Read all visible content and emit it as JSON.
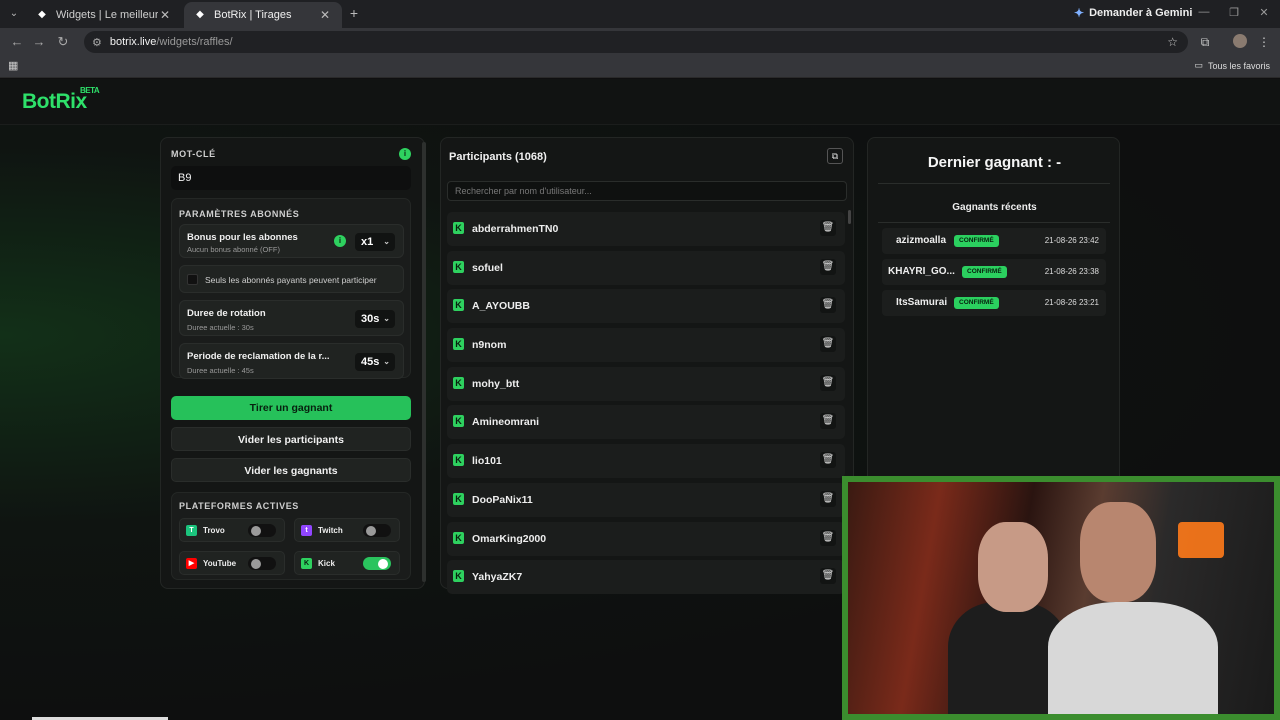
{
  "browser": {
    "tabs": [
      {
        "title": "Widgets | Le meilleur logiciel p",
        "active": false
      },
      {
        "title": "BotRix | Tirages",
        "active": true
      }
    ],
    "gemini_label": "Demander à Gemini",
    "url_host": "botrix.live",
    "url_path": "/widgets/raffles/",
    "bookmarks_label": "Tous les favoris"
  },
  "app": {
    "logo": "BotRix",
    "logo_badge": "BETA"
  },
  "left_panel": {
    "keyword_label": "MOT-CLÉ",
    "keyword_value": "B9",
    "sub_settings_label": "PARAMÈTRES ABONNÉS",
    "bonus_title": "Bonus pour les abonnes",
    "bonus_sub": "Aucun bonus abonné (OFF)",
    "bonus_value": "x1",
    "paid_only_label": "Seuls les abonnés payants peuvent participer",
    "rotation_title": "Duree de rotation",
    "rotation_sub": "Duree actuelle : 30s",
    "rotation_value": "30s",
    "claim_title": "Periode de reclamation de la r...",
    "claim_sub": "Duree actuelle : 45s",
    "claim_value": "45s",
    "draw_button": "Tirer un gagnant",
    "clear_participants_button": "Vider les participants",
    "clear_winners_button": "Vider les gagnants",
    "platforms_label": "PLATEFORMES ACTIVES",
    "platforms": [
      {
        "name": "Trovo",
        "enabled": false,
        "color": "#1bc47d"
      },
      {
        "name": "Twitch",
        "enabled": false,
        "color": "#9146ff"
      },
      {
        "name": "YouTube",
        "enabled": false,
        "color": "#ff0000"
      },
      {
        "name": "Kick",
        "enabled": true,
        "color": "#2ed15f"
      }
    ]
  },
  "participants": {
    "title": "Participants (1068)",
    "search_placeholder": "Rechercher par nom d'utilisateur...",
    "list": [
      "abderrahmenTN0",
      "sofuel",
      "A_AYOUBB",
      "n9nom",
      "mohy_btt",
      "Amineomrani",
      "lio101",
      "DooPaNix11",
      "OmarKing2000",
      "YahyaZK7"
    ]
  },
  "winners": {
    "last_winner": "Dernier gagnant : -",
    "recent_title": "Gagnants récents",
    "recent": [
      {
        "name": "azizmoalla",
        "status": "CONFIRMÉ",
        "date": "21-08-26 23:42"
      },
      {
        "name": "KHAYRI_GO...",
        "status": "CONFIRMÉ",
        "date": "21-08-26 23:38"
      },
      {
        "name": "ItsSamurai",
        "status": "CONFIRMÉ",
        "date": "21-08-26 23:21"
      }
    ]
  },
  "colors": {
    "accent": "#26c15a",
    "background": "#0f0f10"
  }
}
